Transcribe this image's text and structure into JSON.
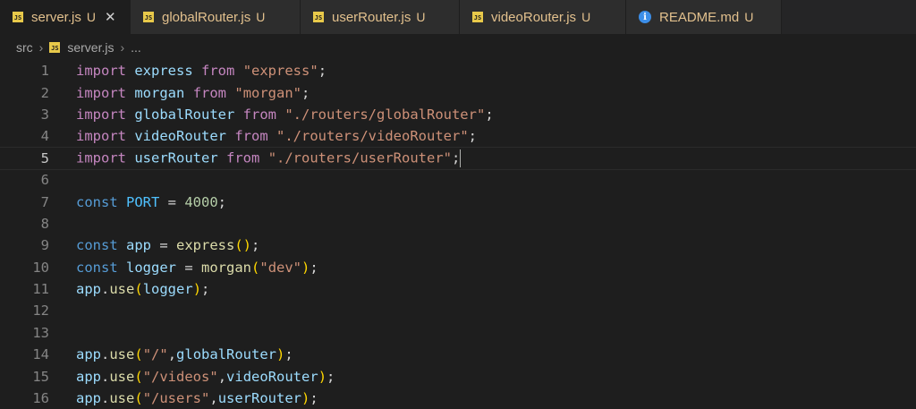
{
  "tabs": [
    {
      "label": "server.js",
      "status": "U",
      "icon": "js-icon",
      "active": true,
      "closable": true
    },
    {
      "label": "globalRouter.js",
      "status": "U",
      "icon": "js-icon",
      "active": false
    },
    {
      "label": "userRouter.js",
      "status": "U",
      "icon": "js-icon",
      "active": false
    },
    {
      "label": "videoRouter.js",
      "status": "U",
      "icon": "js-icon",
      "active": false
    },
    {
      "label": "README.md",
      "status": "U",
      "icon": "info-icon",
      "active": false
    }
  ],
  "icon_glyphs": {
    "js": "JS",
    "info": "i",
    "close": "✕",
    "chevron": "›"
  },
  "breadcrumb": {
    "folder": "src",
    "file": "server.js",
    "more": "..."
  },
  "current_line": 5,
  "lines": [
    {
      "n": "1",
      "tokens": [
        [
          "kw",
          "import"
        ],
        [
          "code",
          " "
        ],
        [
          "var",
          "express"
        ],
        [
          "code",
          " "
        ],
        [
          "kw",
          "from"
        ],
        [
          "code",
          " "
        ],
        [
          "str",
          "\"express\""
        ],
        [
          "punc",
          ";"
        ]
      ]
    },
    {
      "n": "2",
      "tokens": [
        [
          "kw",
          "import"
        ],
        [
          "code",
          " "
        ],
        [
          "var",
          "morgan"
        ],
        [
          "code",
          " "
        ],
        [
          "kw",
          "from"
        ],
        [
          "code",
          " "
        ],
        [
          "str",
          "\"morgan\""
        ],
        [
          "punc",
          ";"
        ]
      ]
    },
    {
      "n": "3",
      "tokens": [
        [
          "kw",
          "import"
        ],
        [
          "code",
          " "
        ],
        [
          "var",
          "globalRouter"
        ],
        [
          "code",
          " "
        ],
        [
          "kw",
          "from"
        ],
        [
          "code",
          " "
        ],
        [
          "str",
          "\"./routers/globalRouter\""
        ],
        [
          "punc",
          ";"
        ]
      ]
    },
    {
      "n": "4",
      "tokens": [
        [
          "kw",
          "import"
        ],
        [
          "code",
          " "
        ],
        [
          "var",
          "videoRouter"
        ],
        [
          "code",
          " "
        ],
        [
          "kw",
          "from"
        ],
        [
          "code",
          " "
        ],
        [
          "str",
          "\"./routers/videoRouter\""
        ],
        [
          "punc",
          ";"
        ]
      ]
    },
    {
      "n": "5",
      "tokens": [
        [
          "kw",
          "import"
        ],
        [
          "code",
          " "
        ],
        [
          "var",
          "userRouter"
        ],
        [
          "code",
          " "
        ],
        [
          "kw",
          "from"
        ],
        [
          "code",
          " "
        ],
        [
          "str",
          "\"./routers/userRouter\""
        ],
        [
          "punc",
          ";"
        ]
      ]
    },
    {
      "n": "6",
      "tokens": []
    },
    {
      "n": "7",
      "tokens": [
        [
          "decl",
          "const"
        ],
        [
          "code",
          " "
        ],
        [
          "const",
          "PORT"
        ],
        [
          "code",
          " = "
        ],
        [
          "num",
          "4000"
        ],
        [
          "punc",
          ";"
        ]
      ]
    },
    {
      "n": "8",
      "tokens": []
    },
    {
      "n": "9",
      "tokens": [
        [
          "decl",
          "const"
        ],
        [
          "code",
          " "
        ],
        [
          "var",
          "app"
        ],
        [
          "code",
          " = "
        ],
        [
          "fn",
          "express"
        ],
        [
          "br1",
          "()"
        ],
        [
          "punc",
          ";"
        ]
      ]
    },
    {
      "n": "10",
      "tokens": [
        [
          "decl",
          "const"
        ],
        [
          "code",
          " "
        ],
        [
          "var",
          "logger"
        ],
        [
          "code",
          " = "
        ],
        [
          "fn",
          "morgan"
        ],
        [
          "br1",
          "("
        ],
        [
          "str",
          "\"dev\""
        ],
        [
          "br1",
          ")"
        ],
        [
          "punc",
          ";"
        ]
      ]
    },
    {
      "n": "11",
      "tokens": [
        [
          "var",
          "app"
        ],
        [
          "punc",
          "."
        ],
        [
          "fn",
          "use"
        ],
        [
          "br1",
          "("
        ],
        [
          "var",
          "logger"
        ],
        [
          "br1",
          ")"
        ],
        [
          "punc",
          ";"
        ]
      ]
    },
    {
      "n": "12",
      "tokens": []
    },
    {
      "n": "13",
      "tokens": []
    },
    {
      "n": "14",
      "tokens": [
        [
          "var",
          "app"
        ],
        [
          "punc",
          "."
        ],
        [
          "fn",
          "use"
        ],
        [
          "br1",
          "("
        ],
        [
          "str",
          "\"/\""
        ],
        [
          "punc",
          ","
        ],
        [
          "var",
          "globalRouter"
        ],
        [
          "br1",
          ")"
        ],
        [
          "punc",
          ";"
        ]
      ]
    },
    {
      "n": "15",
      "tokens": [
        [
          "var",
          "app"
        ],
        [
          "punc",
          "."
        ],
        [
          "fn",
          "use"
        ],
        [
          "br1",
          "("
        ],
        [
          "str",
          "\"/videos\""
        ],
        [
          "punc",
          ","
        ],
        [
          "var",
          "videoRouter"
        ],
        [
          "br1",
          ")"
        ],
        [
          "punc",
          ";"
        ]
      ]
    },
    {
      "n": "16",
      "tokens": [
        [
          "var",
          "app"
        ],
        [
          "punc",
          "."
        ],
        [
          "fn",
          "use"
        ],
        [
          "br1",
          "("
        ],
        [
          "str",
          "\"/users\""
        ],
        [
          "punc",
          ","
        ],
        [
          "var",
          "userRouter"
        ],
        [
          "br1",
          ")"
        ],
        [
          "punc",
          ";"
        ]
      ]
    }
  ]
}
